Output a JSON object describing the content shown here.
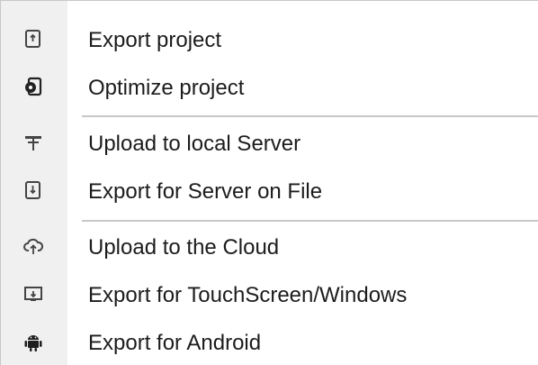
{
  "menu": {
    "items": [
      {
        "label": "Export project",
        "icon": "export-project-icon"
      },
      {
        "label": "Optimize project",
        "icon": "optimize-project-icon"
      },
      {
        "label": "Upload to local Server",
        "icon": "local-server-icon"
      },
      {
        "label": "Export for Server on File",
        "icon": "export-file-icon"
      },
      {
        "label": "Upload to the Cloud",
        "icon": "cloud-upload-icon"
      },
      {
        "label": "Export for TouchScreen/Windows",
        "icon": "touchscreen-icon"
      },
      {
        "label": "Export for Android",
        "icon": "android-icon"
      }
    ]
  }
}
